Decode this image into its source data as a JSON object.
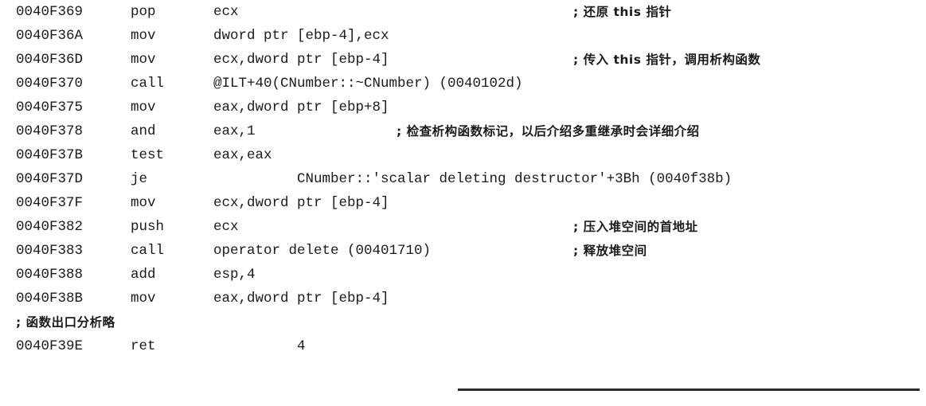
{
  "listing": {
    "rows": [
      {
        "addr": "0040F369",
        "mnem": "pop",
        "oper": "ecx",
        "comment": "; 还原 this 指针"
      },
      {
        "addr": "0040F36A",
        "mnem": "mov",
        "oper": "dword ptr [ebp-4],ecx",
        "comment": ""
      },
      {
        "addr": "0040F36D",
        "mnem": "mov",
        "oper": "ecx,dword ptr [ebp-4]",
        "comment": "; 传入 this 指针，调用析构函数"
      },
      {
        "addr": "0040F370",
        "mnem": "call",
        "oper": "@ILT+40(CNumber::~CNumber) (0040102d)",
        "comment": ""
      },
      {
        "addr": "0040F375",
        "mnem": "mov",
        "oper": "eax,dword ptr [ebp+8]",
        "comment": ""
      },
      {
        "addr": "0040F378",
        "mnem": "and",
        "oper": "eax,1",
        "comment": "; 检查析构函数标记，以后介绍多重继承时会详细介绍"
      },
      {
        "addr": "0040F37B",
        "mnem": "test",
        "oper": "eax,eax",
        "comment": ""
      },
      {
        "addr": "0040F37D",
        "mnem": "je",
        "oper": "          CNumber::'scalar deleting destructor'+3Bh (0040f38b)",
        "comment": ""
      },
      {
        "addr": "0040F37F",
        "mnem": "mov",
        "oper": "ecx,dword ptr [ebp-4]",
        "comment": ""
      },
      {
        "addr": "0040F382",
        "mnem": "push",
        "oper": "ecx",
        "comment": "; 压入堆空间的首地址"
      },
      {
        "addr": "0040F383",
        "mnem": "call",
        "oper": "operator delete (00401710)",
        "comment": "; 释放堆空间"
      },
      {
        "addr": "0040F388",
        "mnem": "add",
        "oper": "esp,4",
        "comment": ""
      },
      {
        "addr": "0040F38B",
        "mnem": "mov",
        "oper": "eax,dword ptr [ebp-4]",
        "comment": ""
      },
      {
        "full_comment": "; 函数出口分析略"
      },
      {
        "addr": "0040F39E",
        "mnem": "ret",
        "oper": "          4",
        "comment": ""
      }
    ]
  }
}
